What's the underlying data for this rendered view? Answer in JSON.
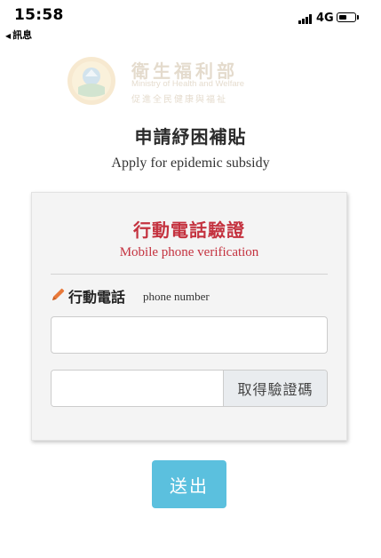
{
  "status_bar": {
    "time": "15:58",
    "back_label": "訊息",
    "network": "4G"
  },
  "logo": {
    "name_cn": "衛生福利部",
    "name_en": "Ministry of Health and Welfare",
    "sub_cn": "促進全民健康與福祉"
  },
  "page": {
    "title": "申請紓困補貼",
    "subtitle": "Apply for epidemic subsidy"
  },
  "card": {
    "title": "行動電話驗證",
    "subtitle": "Mobile phone verification",
    "field_label_cn": "行動電話",
    "field_label_en": "phone number",
    "phone_placeholder": "",
    "code_placeholder": "",
    "get_code_label": "取得驗證碼"
  },
  "submit_label": "送出",
  "colors": {
    "accent_red": "#c4323f",
    "submit_blue": "#5bc0de",
    "pencil_orange": "#e8793a"
  }
}
